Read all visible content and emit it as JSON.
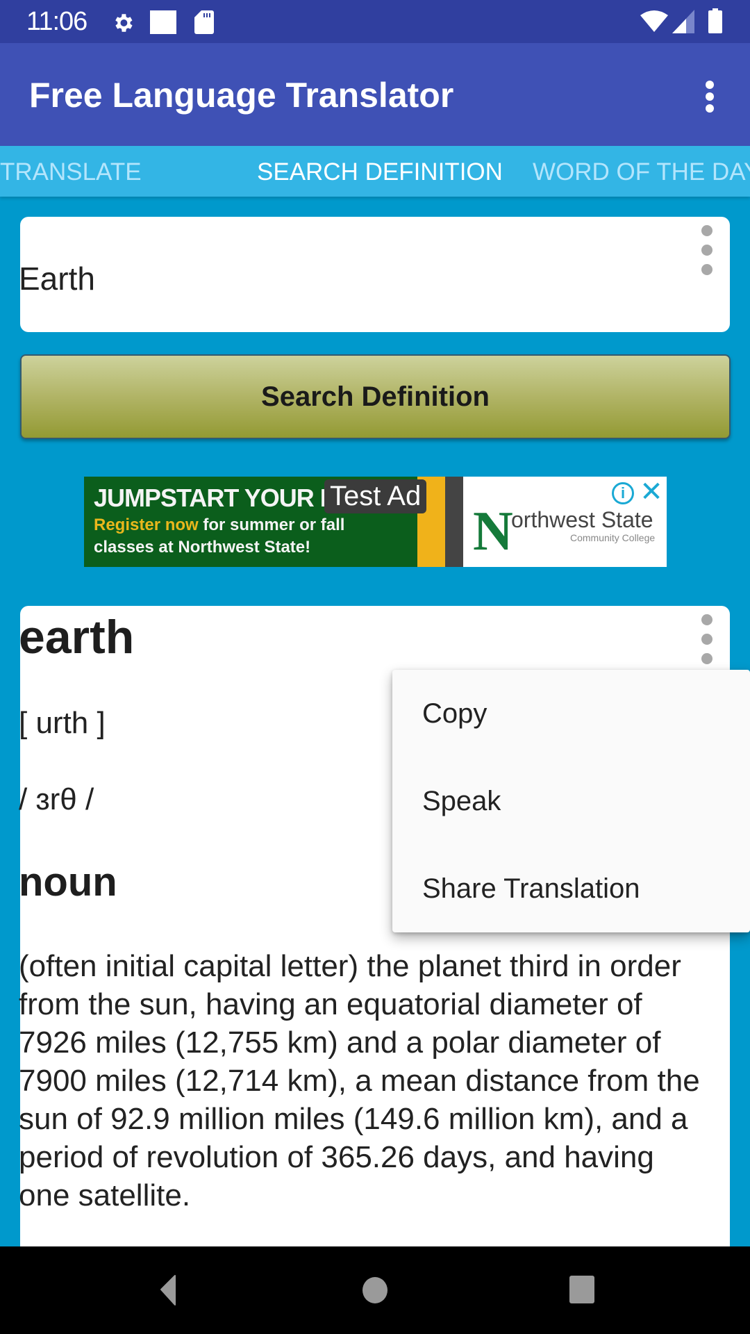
{
  "status_bar": {
    "time": "11:06",
    "left_icons": [
      "gear-icon",
      "square-notification-icon",
      "sd-card-icon"
    ],
    "right_icons": [
      "wifi-icon",
      "signal-icon",
      "battery-icon"
    ]
  },
  "app_bar": {
    "title": "Free Language Translator",
    "overflow_icon": "more-vert-icon"
  },
  "tabs": [
    {
      "label": "TRANSLATE",
      "active": false
    },
    {
      "label": "SEARCH DEFINITION",
      "active": true
    },
    {
      "label": "WORD OF THE DAY",
      "active": false
    }
  ],
  "search": {
    "value": "Earth",
    "button_label": "Search Definition"
  },
  "ad": {
    "label": "Test Ad",
    "headline": "JUMPSTART YOUR F",
    "line2_highlight": "Register now",
    "line2_rest": " for summer or fall",
    "line3": "classes at Northwest State!",
    "logo_initial": "N",
    "logo_text": "orthwest State",
    "logo_subtext": "Community College",
    "info_icon": "i",
    "close_icon": "✕"
  },
  "definition": {
    "word": "earth",
    "pronunciation": "[ urth ]",
    "ipa": "/ ɜrθ /",
    "part_of_speech": "noun",
    "text": "(often initial capital letter) the planet third in order from the sun, having an equatorial diameter of 7926 miles (12,755 km) and a polar diameter of 7900 miles (12,714 km), a mean distance from the sun of 92.9 million miles (149.6 million km), and a period of revolution of 365.26 days, and having one satellite."
  },
  "popup_menu": {
    "items": [
      {
        "label": "Copy"
      },
      {
        "label": "Speak"
      },
      {
        "label": "Share Translation"
      }
    ]
  },
  "colors": {
    "status_bar": "#303f9f",
    "app_bar": "#3f51b5",
    "tab_bar": "#33b5e5",
    "background": "#0099cc",
    "button_top": "#cdd29c",
    "button_bottom": "#939a33"
  }
}
